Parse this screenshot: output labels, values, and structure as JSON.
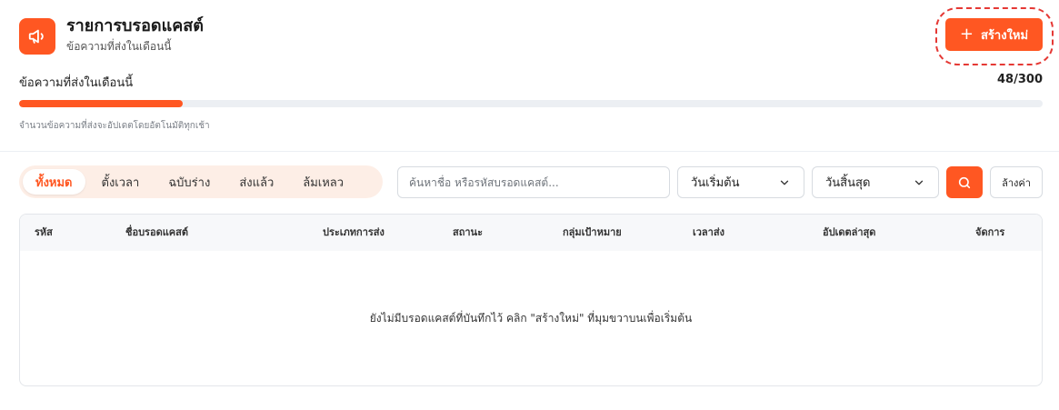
{
  "header": {
    "title": "รายการบรอดแคสต์",
    "subtitle": "ข้อความที่ส่งในเดือนนี้",
    "icon": "megaphone-icon",
    "create_label": "สร้างใหม่"
  },
  "usage": {
    "label": "ข้อความที่ส่งในเดือนนี้",
    "count_text": "48/300",
    "used": 48,
    "limit": 300,
    "note": "จำนวนข้อความที่ส่งจะอัปเดตโดยอัตโนมัติทุกเช้า"
  },
  "tabs": [
    {
      "label": "ทั้งหมด",
      "active": true
    },
    {
      "label": "ตั้งเวลา",
      "active": false
    },
    {
      "label": "ฉบับร่าง",
      "active": false
    },
    {
      "label": "ส่งแล้ว",
      "active": false
    },
    {
      "label": "ล้มเหลว",
      "active": false
    }
  ],
  "filters": {
    "search_placeholder": "ค้นหาชื่อ หรือรหัสบรอดแคสต์...",
    "start_date_label": "วันเริ่มต้น",
    "end_date_label": "วันสิ้นสุด",
    "reset_label": "ล้างค่า"
  },
  "table": {
    "columns": [
      "รหัส",
      "ชื่อบรอดแคสต์",
      "ประเภทการส่ง",
      "สถานะ",
      "กลุ่มเป้าหมาย",
      "เวลาส่ง",
      "อัปเดตล่าสุด",
      "จัดการ"
    ],
    "empty_message": "ยังไม่มีบรอดแคสต์ที่บันทึกไว้ คลิก \"สร้างใหม่\" ที่มุมขวาบนเพื่อเริ่มต้น"
  },
  "colors": {
    "accent": "#ff5722",
    "annotation": "#e53935"
  }
}
